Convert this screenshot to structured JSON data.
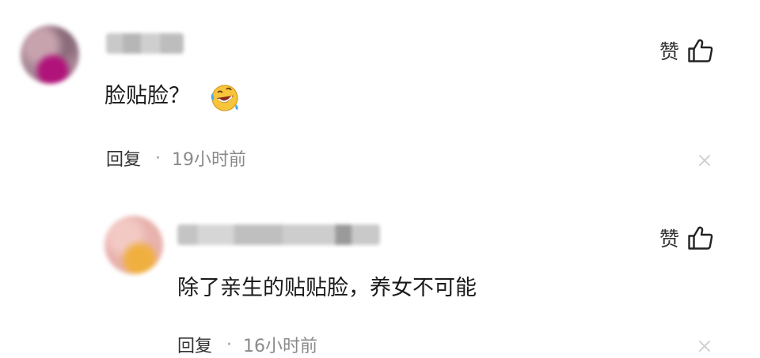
{
  "comments": [
    {
      "username": "",
      "content": "脸贴脸？",
      "emoji": "rolling-on-floor-laughing-emoji",
      "like_label": "赞",
      "reply_label": "回复",
      "separator": "·",
      "time": "19小时前"
    },
    {
      "username": "",
      "content": "除了亲生的贴贴脸，养女不可能",
      "like_label": "赞",
      "reply_label": "回复",
      "separator": "·",
      "time": "16小时前"
    }
  ],
  "colors": {
    "text": "#1a1a1a",
    "muted": "#8a8a8a",
    "close": "#cccccc"
  },
  "icons": [
    "thumbs-up-icon",
    "close-icon",
    "laughing-emoji"
  ]
}
